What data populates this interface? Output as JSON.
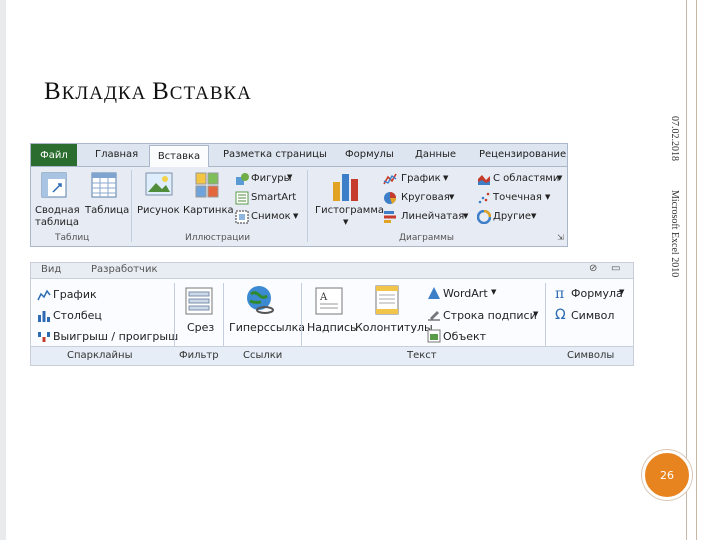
{
  "slide": {
    "title_first_big": "В",
    "title_first_rest": "КЛАДКА ",
    "title_second_big": "В",
    "title_second_rest": "СТАВКА",
    "date": "07.02.2018",
    "footer_vertical": "Microsoft Excel 2010",
    "page_number": "26"
  },
  "ribbon1": {
    "tabs": {
      "file": "Файл",
      "home": "Главная",
      "insert": "Вставка",
      "page_layout": "Разметка страницы",
      "formulas": "Формулы",
      "data": "Данные",
      "review": "Рецензирование"
    },
    "buttons": {
      "pivot_line1": "Сводная",
      "pivot_line2": "таблица",
      "table": "Таблица",
      "picture": "Рисунок",
      "clipart": "Картинка",
      "shapes": "Фигуры",
      "smartart": "SmartArt",
      "screenshot": "Снимок",
      "histogram": "Гистограмма",
      "line": "График",
      "pie": "Круговая",
      "bar": "Линейчатая",
      "area": "С областями",
      "scatter": "Точечная",
      "other": "Другие"
    },
    "groups": {
      "tables": "Таблиц",
      "illustrations": "Иллюстрации",
      "charts": "Диаграммы"
    }
  },
  "ribbon2": {
    "top_tabs": {
      "view": "Вид",
      "developer": "Разработчик"
    },
    "buttons": {
      "spark_line": "График",
      "spark_column": "Столбец",
      "spark_winloss": "Выигрыш / проигрыш",
      "slicer": "Срез",
      "hyperlink": "Гиперссылка",
      "textbox": "Надпись",
      "header_footer": "Колонтитулы",
      "wordart": "WordArt",
      "signature_line": "Строка подписи",
      "object": "Объект",
      "formula": "Формула",
      "symbol": "Символ"
    },
    "groups": {
      "sparklines": "Спарклайны",
      "filter": "Фильтр",
      "links": "Ссылки",
      "text": "Текст",
      "symbols": "Символы"
    }
  },
  "colors": {
    "file_tab": "#2a6d2e",
    "page_circle": "#e8841f",
    "ribbon_bg": "#e7ecf4"
  }
}
